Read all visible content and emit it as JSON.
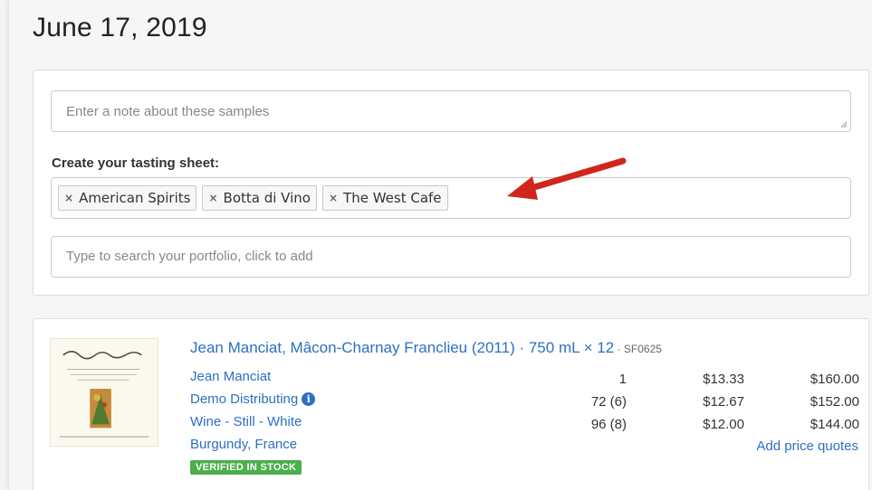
{
  "date_title": "June 17, 2019",
  "note": {
    "placeholder": "Enter a note about these samples"
  },
  "tasting_sheet": {
    "label": "Create your tasting sheet:",
    "tags": [
      "American Spirits",
      "Botta di Vino",
      "The West Cafe"
    ],
    "remove_glyph": "×"
  },
  "portfolio_search": {
    "placeholder": "Type to search your portfolio, click to add"
  },
  "product": {
    "title": "Jean Manciat, Mâcon-Charnay Franclieu (2011) · 750 mL × 12",
    "sku": " · SF0625",
    "producer": "Jean Manciat",
    "distributor": "Demo Distributing",
    "category": "Wine - Still - White",
    "region": "Burgundy, France",
    "status_badge": "VERIFIED IN STOCK",
    "pricing": [
      {
        "qty": "1",
        "unit": "$13.33",
        "case": "$160.00"
      },
      {
        "qty": "72 (6)",
        "unit": "$12.67",
        "case": "$152.00"
      },
      {
        "qty": "96 (8)",
        "unit": "$12.00",
        "case": "$144.00"
      }
    ],
    "add_quotes_label": "Add price quotes"
  },
  "colors": {
    "link": "#2d6fc4",
    "arrow": "#d0261c",
    "badge": "#4cae4c"
  },
  "icons": [
    "remove-tag-icon",
    "info-icon",
    "red-arrow-icon",
    "resize-grip-icon"
  ]
}
